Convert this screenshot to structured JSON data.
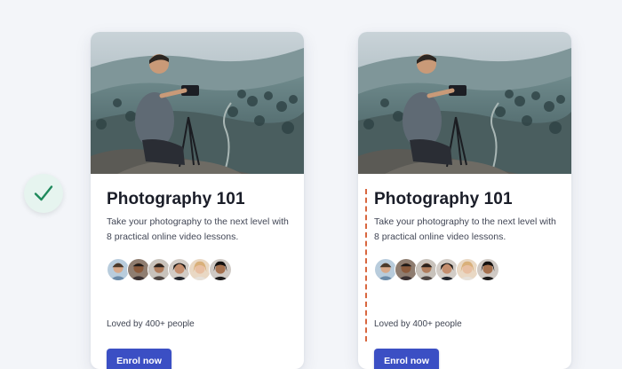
{
  "cards": [
    {
      "title": "Photography 101",
      "description": "Take your photography to the next level with 8 practical online video lessons.",
      "social_proof": "Loved by 400+ people",
      "cta_label": "Enrol now",
      "image_subject": "photographer with camera on tripod overlooking valley"
    },
    {
      "title": "Photography 101",
      "description": "Take your photography to the next level with 8 practical online video lessons.",
      "social_proof": "Loved by 400+ people",
      "cta_label": "Enrol now",
      "image_subject": "photographer with camera on tripod overlooking valley"
    }
  ],
  "badge": {
    "icon": "checkmark-icon",
    "color": "#1f8a5c"
  },
  "guide": {
    "style": "dashed",
    "color": "#d9673f"
  },
  "colors": {
    "accent": "#3b4fc4",
    "background": "#f3f5f9",
    "title": "#1a1d28"
  }
}
